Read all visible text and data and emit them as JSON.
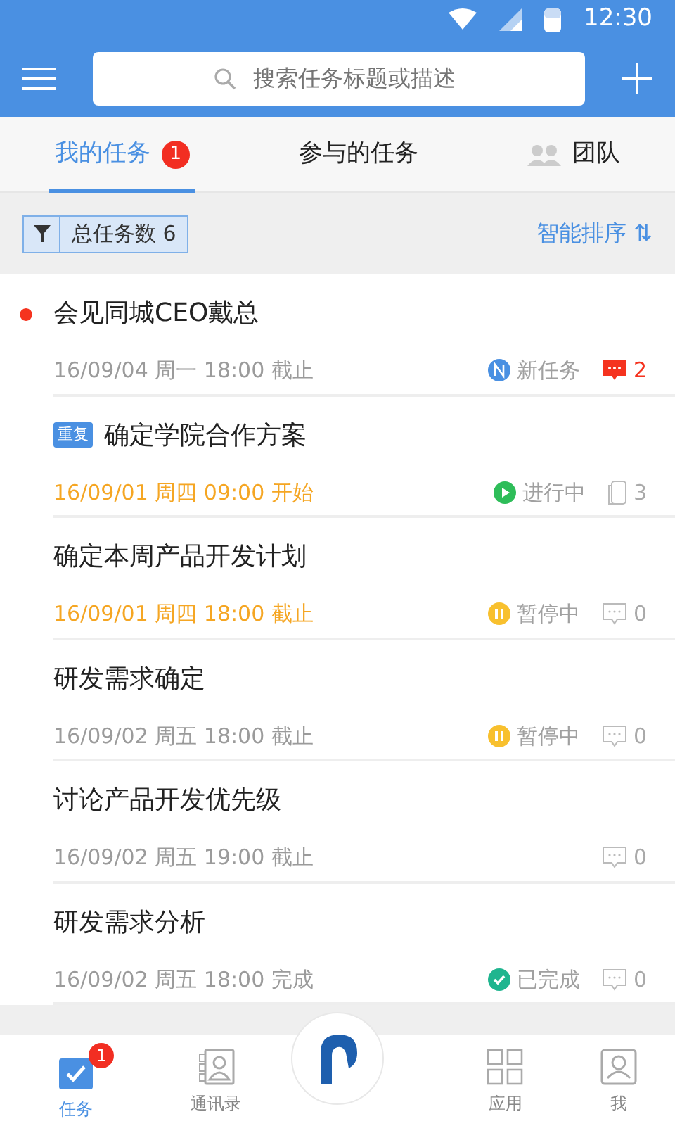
{
  "status_bar": {
    "time": "12:30"
  },
  "header": {
    "search_placeholder": "搜索任务标题或描述"
  },
  "tabs": [
    {
      "label": "我的任务",
      "selected": true,
      "badge": "1",
      "kind": "plain"
    },
    {
      "label": "参与的任务",
      "selected": false,
      "kind": "plain"
    },
    {
      "label": "团队",
      "selected": false,
      "kind": "team"
    }
  ],
  "filter": {
    "label": "总任务数 6",
    "sort": "智能排序 ⇅"
  },
  "tasks": [
    {
      "title": "会见同城CEO戴总",
      "unread": true,
      "date": "16/09/04 周一 18:00 截止",
      "date_highlight": false,
      "status": {
        "kind": "new",
        "label": "新任务"
      },
      "counter": {
        "kind": "comment",
        "value": "2",
        "alert": true
      }
    },
    {
      "title": "确定学院合作方案",
      "tag": "重复",
      "unread": false,
      "date": "16/09/01 周四 09:00 开始",
      "date_highlight": true,
      "status": {
        "kind": "running",
        "label": "进行中"
      },
      "counter": {
        "kind": "attachment",
        "value": "3",
        "alert": false
      }
    },
    {
      "title": "确定本周产品开发计划",
      "unread": false,
      "date": "16/09/01 周四 18:00 截止",
      "date_highlight": true,
      "status": {
        "kind": "paused",
        "label": "暂停中"
      },
      "counter": {
        "kind": "comment",
        "value": "0",
        "alert": false
      }
    },
    {
      "title": "研发需求确定",
      "unread": false,
      "date": "16/09/02 周五 18:00 截止",
      "date_highlight": false,
      "status": {
        "kind": "paused",
        "label": "暂停中"
      },
      "counter": {
        "kind": "comment",
        "value": "0",
        "alert": false
      }
    },
    {
      "title": "讨论产品开发优先级",
      "unread": false,
      "date": "16/09/02 周五 19:00 截止",
      "date_highlight": false,
      "counter": {
        "kind": "comment",
        "value": "0",
        "alert": false
      }
    },
    {
      "title": "研发需求分析",
      "unread": false,
      "date": "16/09/02 周五 18:00 完成",
      "date_highlight": false,
      "status": {
        "kind": "done",
        "label": "已完成"
      },
      "counter": {
        "kind": "comment",
        "value": "0",
        "alert": false
      }
    }
  ],
  "bottom_nav": [
    {
      "label": "任务",
      "kind": "tasks",
      "selected": true,
      "badge": "1"
    },
    {
      "label": "通讯录",
      "kind": "contacts",
      "selected": false
    },
    {
      "kind": "logo"
    },
    {
      "label": "应用",
      "kind": "apps",
      "selected": false
    },
    {
      "label": "我",
      "kind": "me",
      "selected": false
    }
  ]
}
